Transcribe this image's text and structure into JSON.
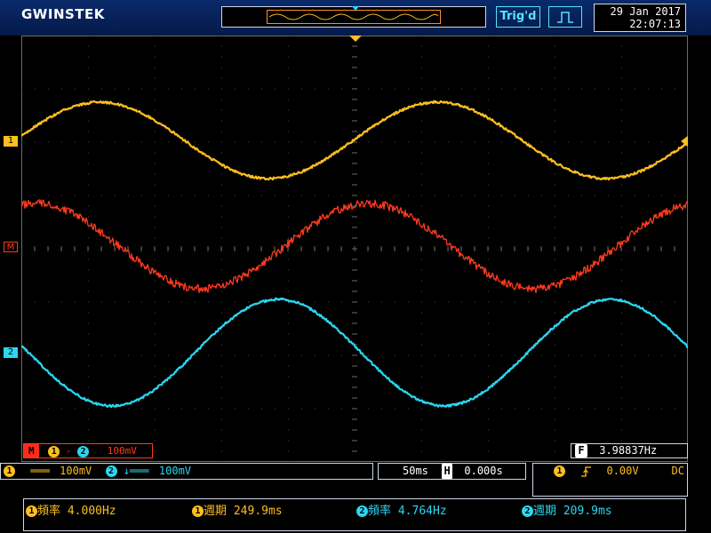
{
  "header": {
    "brand": "GWINSTEK",
    "trigger_status": "Trig'd",
    "trigger_edge_icon": "rising-pulse-icon",
    "date": "29 Jan 2017",
    "time": "22:07:13"
  },
  "colors": {
    "ch1": "#ffbf1e",
    "math": "#ff3a1e",
    "ch2": "#2bd7f0",
    "grid": "#4b4b4b"
  },
  "channel_markers": {
    "ch1": "1",
    "math": "M",
    "ch2": "2"
  },
  "math_info": {
    "label": "M",
    "src1": "1",
    "op": "-",
    "src2": "2",
    "scale": "100mV"
  },
  "frequency_counter": {
    "label": "F",
    "value": "3.98837Hz"
  },
  "status_bar": {
    "ch1_num": "1",
    "ch1_coupling": "═══",
    "ch1_scale": "100mV",
    "ch2_num": "2",
    "ch2_coupling": "↓═══",
    "ch2_scale": "100mV",
    "timebase": "50ms",
    "h_icon": "H",
    "h_position": "0.000s",
    "trig_src": "1",
    "trig_slope_icon": "rising-edge-icon",
    "trig_level": "0.00V",
    "trig_coupling": "DC"
  },
  "measurements": [
    {
      "src": "1",
      "name": "頻率",
      "value": "4.000Hz"
    },
    {
      "src": "1",
      "name": "週期",
      "value": "249.9ms"
    },
    {
      "src": "2",
      "name": "頻率",
      "value": "4.764Hz"
    },
    {
      "src": "2",
      "name": "週期",
      "value": "209.9ms"
    }
  ]
}
